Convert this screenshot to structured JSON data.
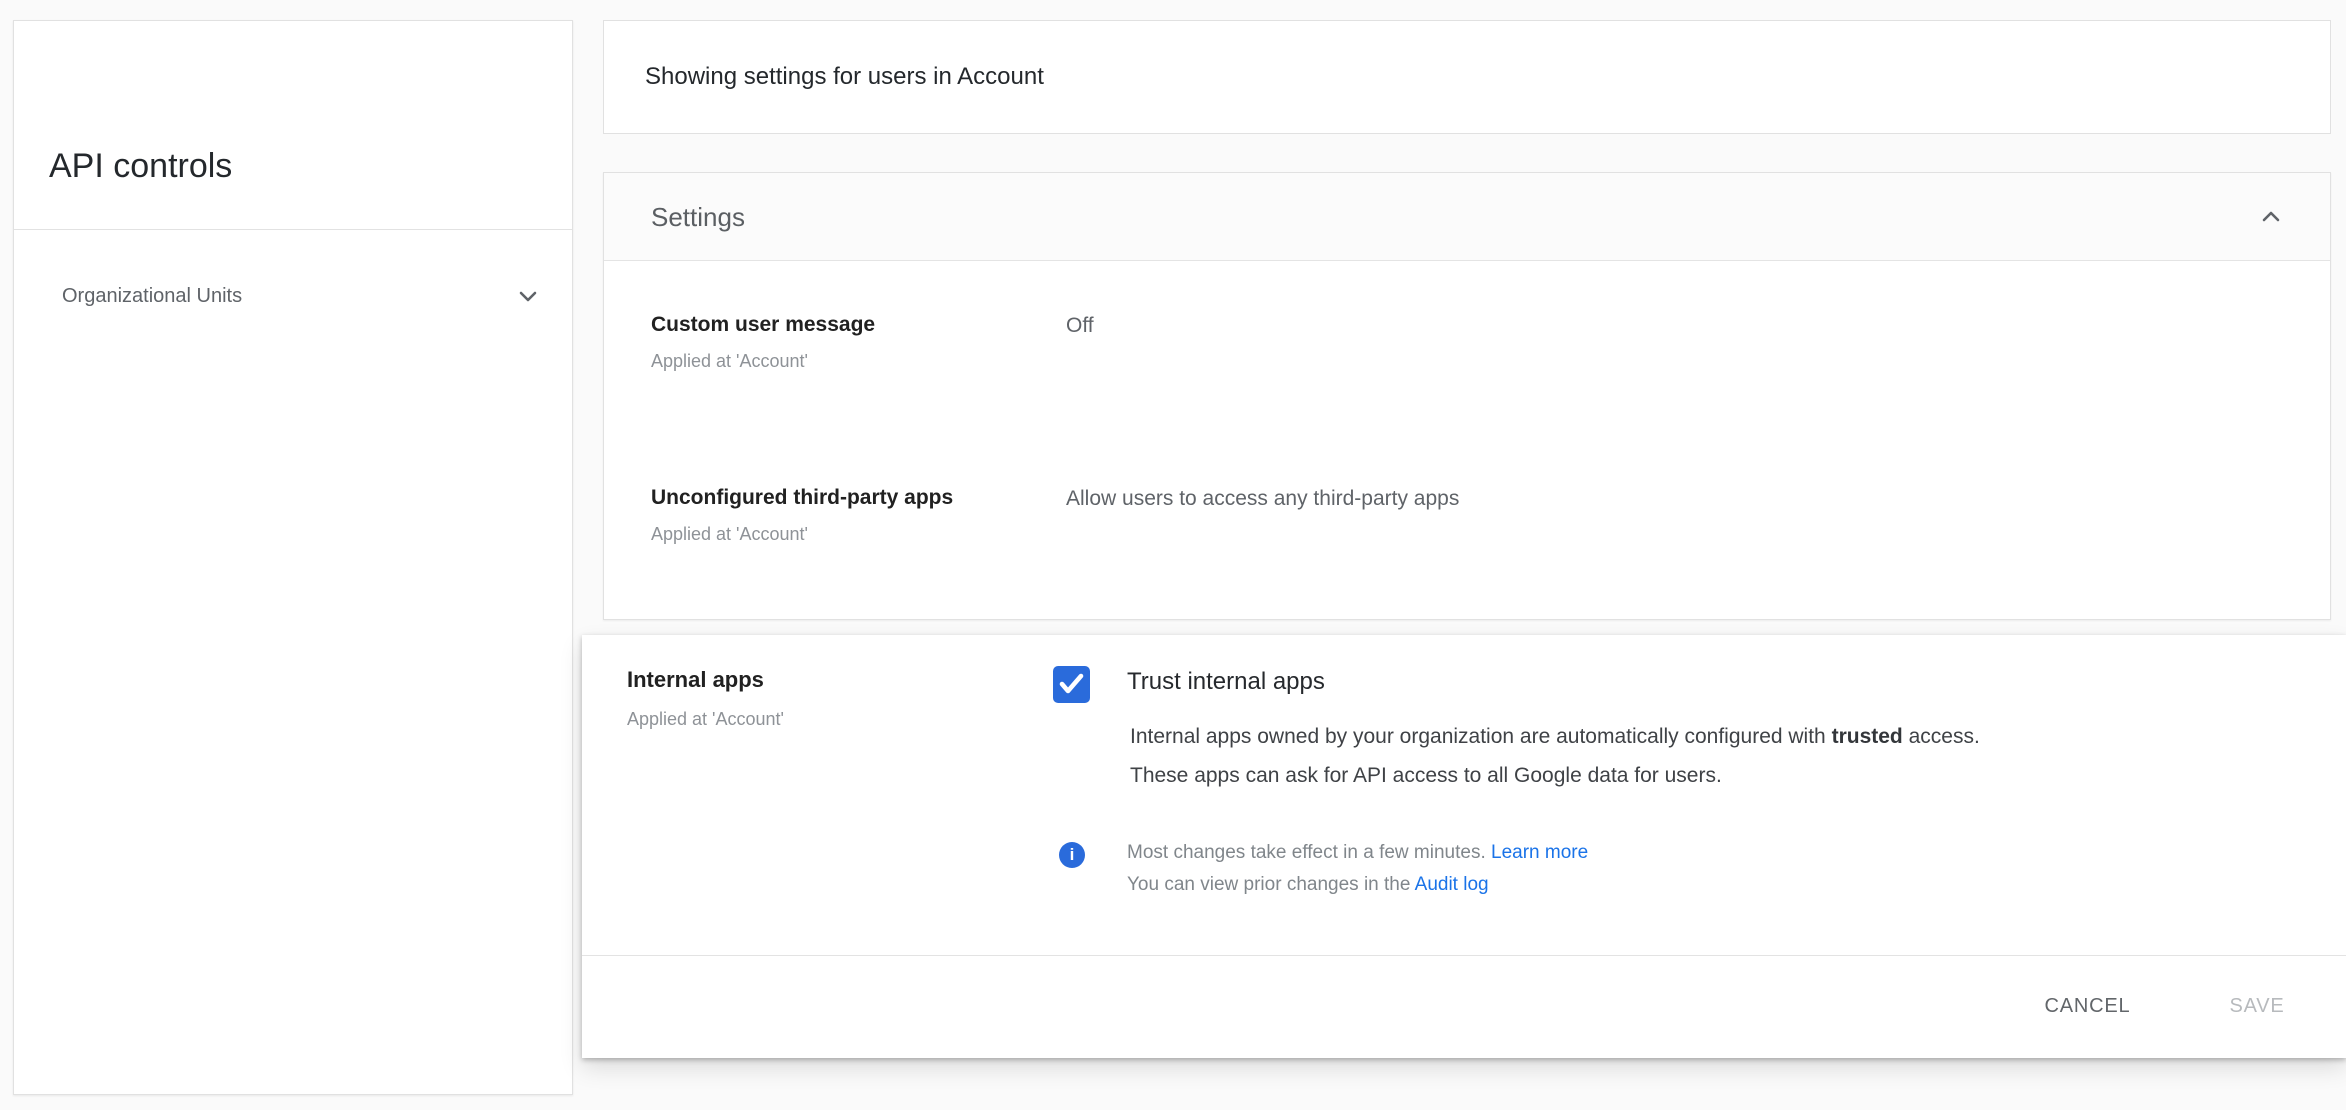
{
  "colors": {
    "accent_blue": "#2a6bdb",
    "link_blue": "#1a73e8",
    "card_border": "#e1e1e1",
    "text_dark": "#202124",
    "text_gray": "#5f6368",
    "text_light_gray": "#8e9297"
  },
  "sidebar": {
    "title": "API controls",
    "nav_item": {
      "label": "Organizational Units",
      "icon": "chevron-down"
    }
  },
  "topbar": {
    "text": "Showing settings for users in Account"
  },
  "settings_card": {
    "title": "Settings",
    "collapse_icon": "chevron-up",
    "rows": [
      {
        "label": "Custom user message",
        "applied": "Applied at 'Account'",
        "value": "Off"
      },
      {
        "label": "Unconfigured third-party apps",
        "applied": "Applied at 'Account'",
        "value": "Allow users to access any third-party apps"
      }
    ]
  },
  "editor_card": {
    "label": "Internal apps",
    "applied": "Applied at 'Account'",
    "checkbox": {
      "checked": true,
      "label": "Trust internal apps"
    },
    "description": {
      "line1_before": "Internal apps owned by your organization are automatically configured with ",
      "line1_bold": "trusted",
      "line1_after": " access.",
      "line2": "These apps can ask for API access to all Google data for users."
    },
    "note": {
      "icon": "info-icon",
      "line1_text": "Most changes take effect in a few minutes. ",
      "line1_link": "Learn more",
      "line2_text": "You can view prior changes in the ",
      "line2_link": "Audit log"
    },
    "buttons": {
      "cancel": "CANCEL",
      "save": "SAVE",
      "save_enabled": false
    }
  }
}
